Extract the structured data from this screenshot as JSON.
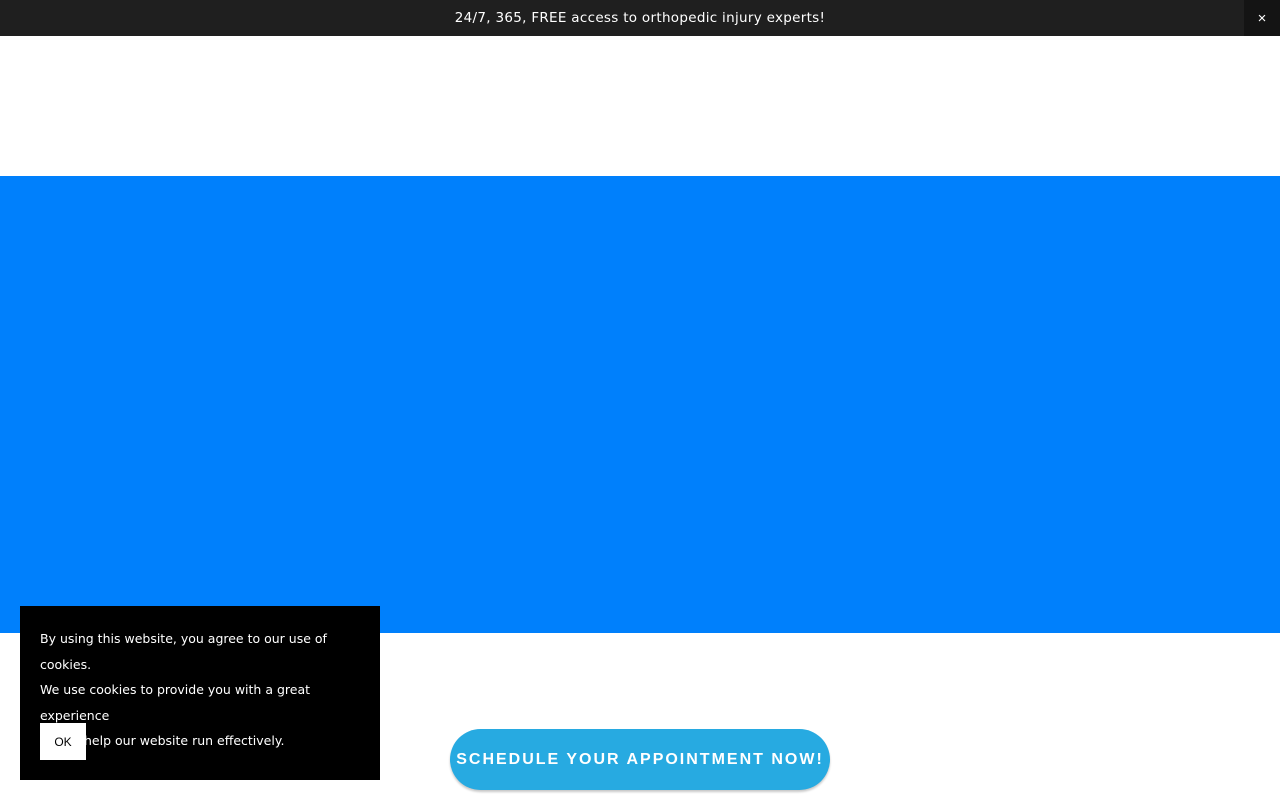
{
  "announcement": {
    "text": "24/7, 365, FREE access to orthopedic injury experts!",
    "close_label": "×"
  },
  "hero": {
    "background_color": "#0080fc"
  },
  "cta": {
    "label": "SCHEDULE YOUR APPOINTMENT NOW!",
    "color": "#27aae1"
  },
  "cookie_banner": {
    "lines": [
      "By using this website, you agree to our use of cookies.",
      "We use cookies to provide you with a great experience",
      "and to help our website run effectively."
    ],
    "ok_label": "OK"
  }
}
